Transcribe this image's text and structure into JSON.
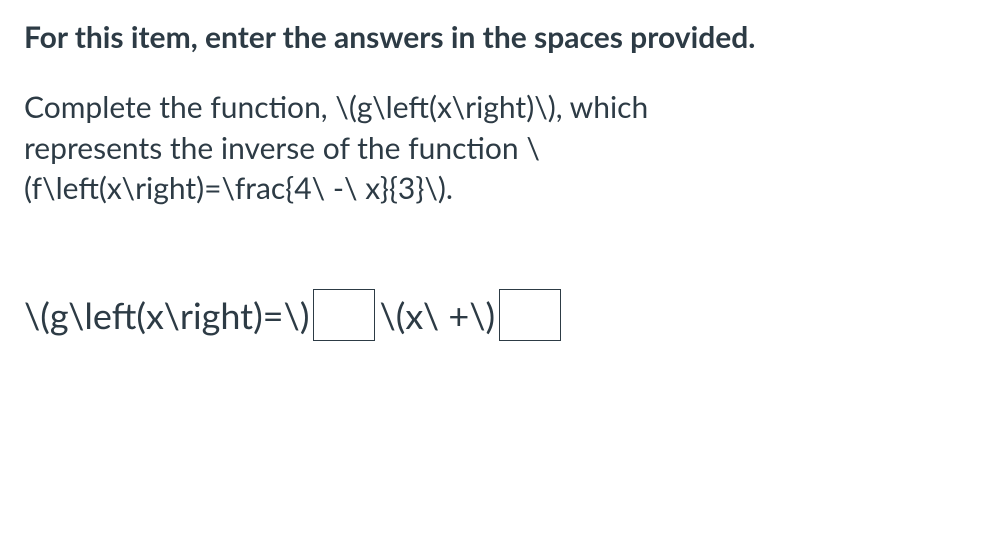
{
  "instruction": "For this item, enter the answers in the spaces provided.",
  "prompt": {
    "line1": "Complete the function, \\(g\\left(x\\right)\\), which",
    "line2": "represents the inverse of the function \\",
    "line3": "(f\\left(x\\right)=\\frac{4\\ -\\ x}{3}\\)."
  },
  "answer": {
    "part1": "\\(g\\left(x\\right)=\\)",
    "part2": "\\(x\\ +\\)"
  },
  "inputs": {
    "box1": "",
    "box2": ""
  }
}
